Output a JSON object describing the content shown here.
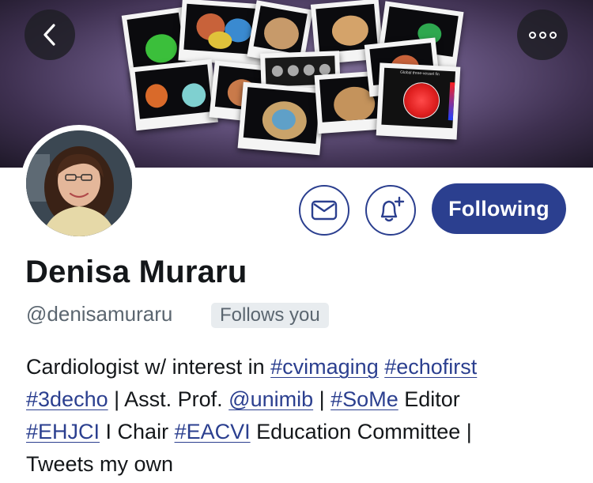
{
  "header": {
    "back_icon": "chevron-left-icon",
    "more_icon": "more-horizontal-icon",
    "banner_chart_title": "Global three-vessel fin"
  },
  "actions": {
    "message_icon": "mail-icon",
    "notify_icon": "bell-plus-icon",
    "following_label": "Following",
    "accent_color": "#2b3f8f"
  },
  "profile": {
    "name": "Denisa Muraru",
    "handle": "@denisamuraru",
    "follows_badge": "Follows you"
  },
  "bio": {
    "line1": [
      {
        "text": "Cardiologist w/ interest in ",
        "link": false
      },
      {
        "text": "#cvimaging",
        "link": true
      },
      {
        "text": " ",
        "link": false
      },
      {
        "text": "#echofirst",
        "link": true
      }
    ],
    "line2": [
      {
        "text": "#3decho",
        "link": true
      },
      {
        "text": " | Asst. Prof. ",
        "link": false
      },
      {
        "text": "@unimib",
        "link": true
      },
      {
        "text": " | ",
        "link": false
      },
      {
        "text": "#SoMe",
        "link": true
      },
      {
        "text": " Editor",
        "link": false
      }
    ],
    "line3": [
      {
        "text": "#EHJCI",
        "link": true
      },
      {
        "text": " I Chair ",
        "link": false
      },
      {
        "text": "#EACVI",
        "link": true
      },
      {
        "text": " Education Committee |",
        "link": false
      }
    ],
    "line4": [
      {
        "text": "Tweets my own",
        "link": false
      }
    ]
  }
}
